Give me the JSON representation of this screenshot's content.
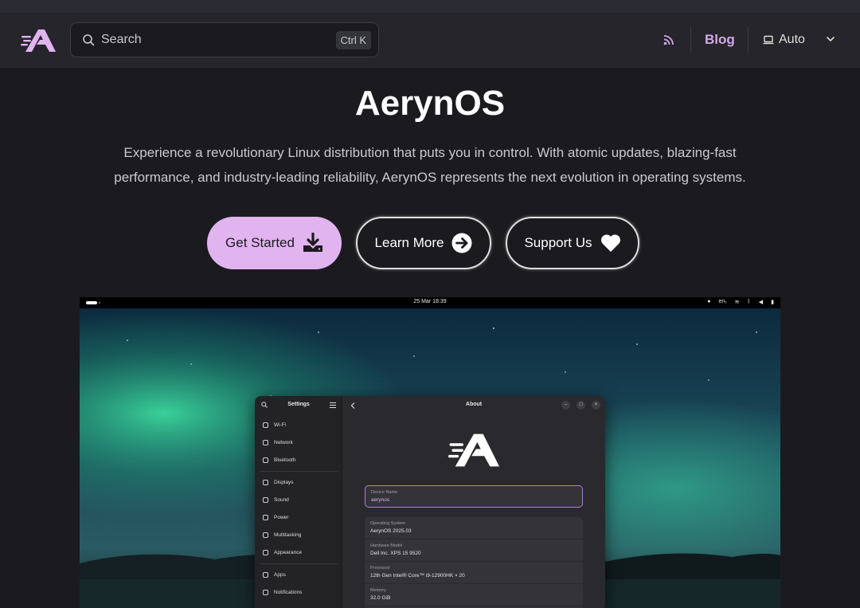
{
  "nav": {
    "search_placeholder": "Search",
    "search_shortcut": "Ctrl K",
    "blog_label": "Blog",
    "theme_label": "Auto",
    "icons": [
      "logo-icon",
      "search-icon",
      "rss-icon",
      "laptop-icon",
      "chevron-down-icon"
    ]
  },
  "hero": {
    "title": "AerynOS",
    "description": "Experience a revolutionary Linux distribution that puts you in control. With atomic updates, blazing-fast performance, and industry-leading reliability, AerynOS represents the next evolution in operating systems.",
    "buttons": {
      "get_started": "Get Started",
      "learn_more": "Learn More",
      "support_us": "Support Us"
    }
  },
  "colors": {
    "accent": "#d3a8e8",
    "primary_button": "#e1b3ef",
    "background": "#1b1b1f",
    "navbar": "#25252b"
  },
  "screenshot": {
    "topbar_time": "25 Mar  18:39",
    "topbar_lang": "en₁",
    "settings_title": "Settings",
    "about_title": "About",
    "sidebar_items": [
      "Wi-Fi",
      "Network",
      "Bluetooth",
      "Displays",
      "Sound",
      "Power",
      "Multitasking",
      "Appearance",
      "Apps",
      "Notifications"
    ],
    "device_name_label": "Device Name",
    "device_name_value": "aerynos",
    "info": [
      {
        "label": "Operating System",
        "value": "AerynOS 2025.03"
      },
      {
        "label": "Hardware Model",
        "value": "Dell Inc. XPS 15 9520"
      },
      {
        "label": "Processor",
        "value": "12th Gen Intel® Core™ i9-12900HK × 20"
      },
      {
        "label": "Memory",
        "value": "32.0 GiB"
      }
    ]
  }
}
